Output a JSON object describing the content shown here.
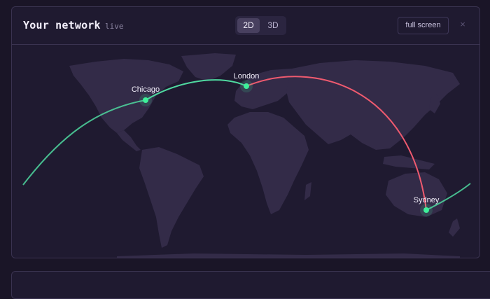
{
  "header": {
    "title": "Your network",
    "status": "live"
  },
  "view_toggle": {
    "options": [
      "2D",
      "3D"
    ],
    "selected": "2D"
  },
  "actions": {
    "fullscreen_label": "full screen",
    "close_label": "×"
  },
  "map": {
    "cities": [
      {
        "name": "Chicago"
      },
      {
        "name": "London"
      },
      {
        "name": "Sydney"
      }
    ],
    "routes": [
      {
        "from": "Chicago",
        "to": "London",
        "color": "#4fd9a0"
      },
      {
        "from": "London",
        "to": "Sydney",
        "color": "#ef5a6f"
      }
    ],
    "colors": {
      "land": "#332b48",
      "node": "#3ef09a",
      "green_route": "#4fd9a0",
      "red_route": "#ef5a6f"
    }
  }
}
